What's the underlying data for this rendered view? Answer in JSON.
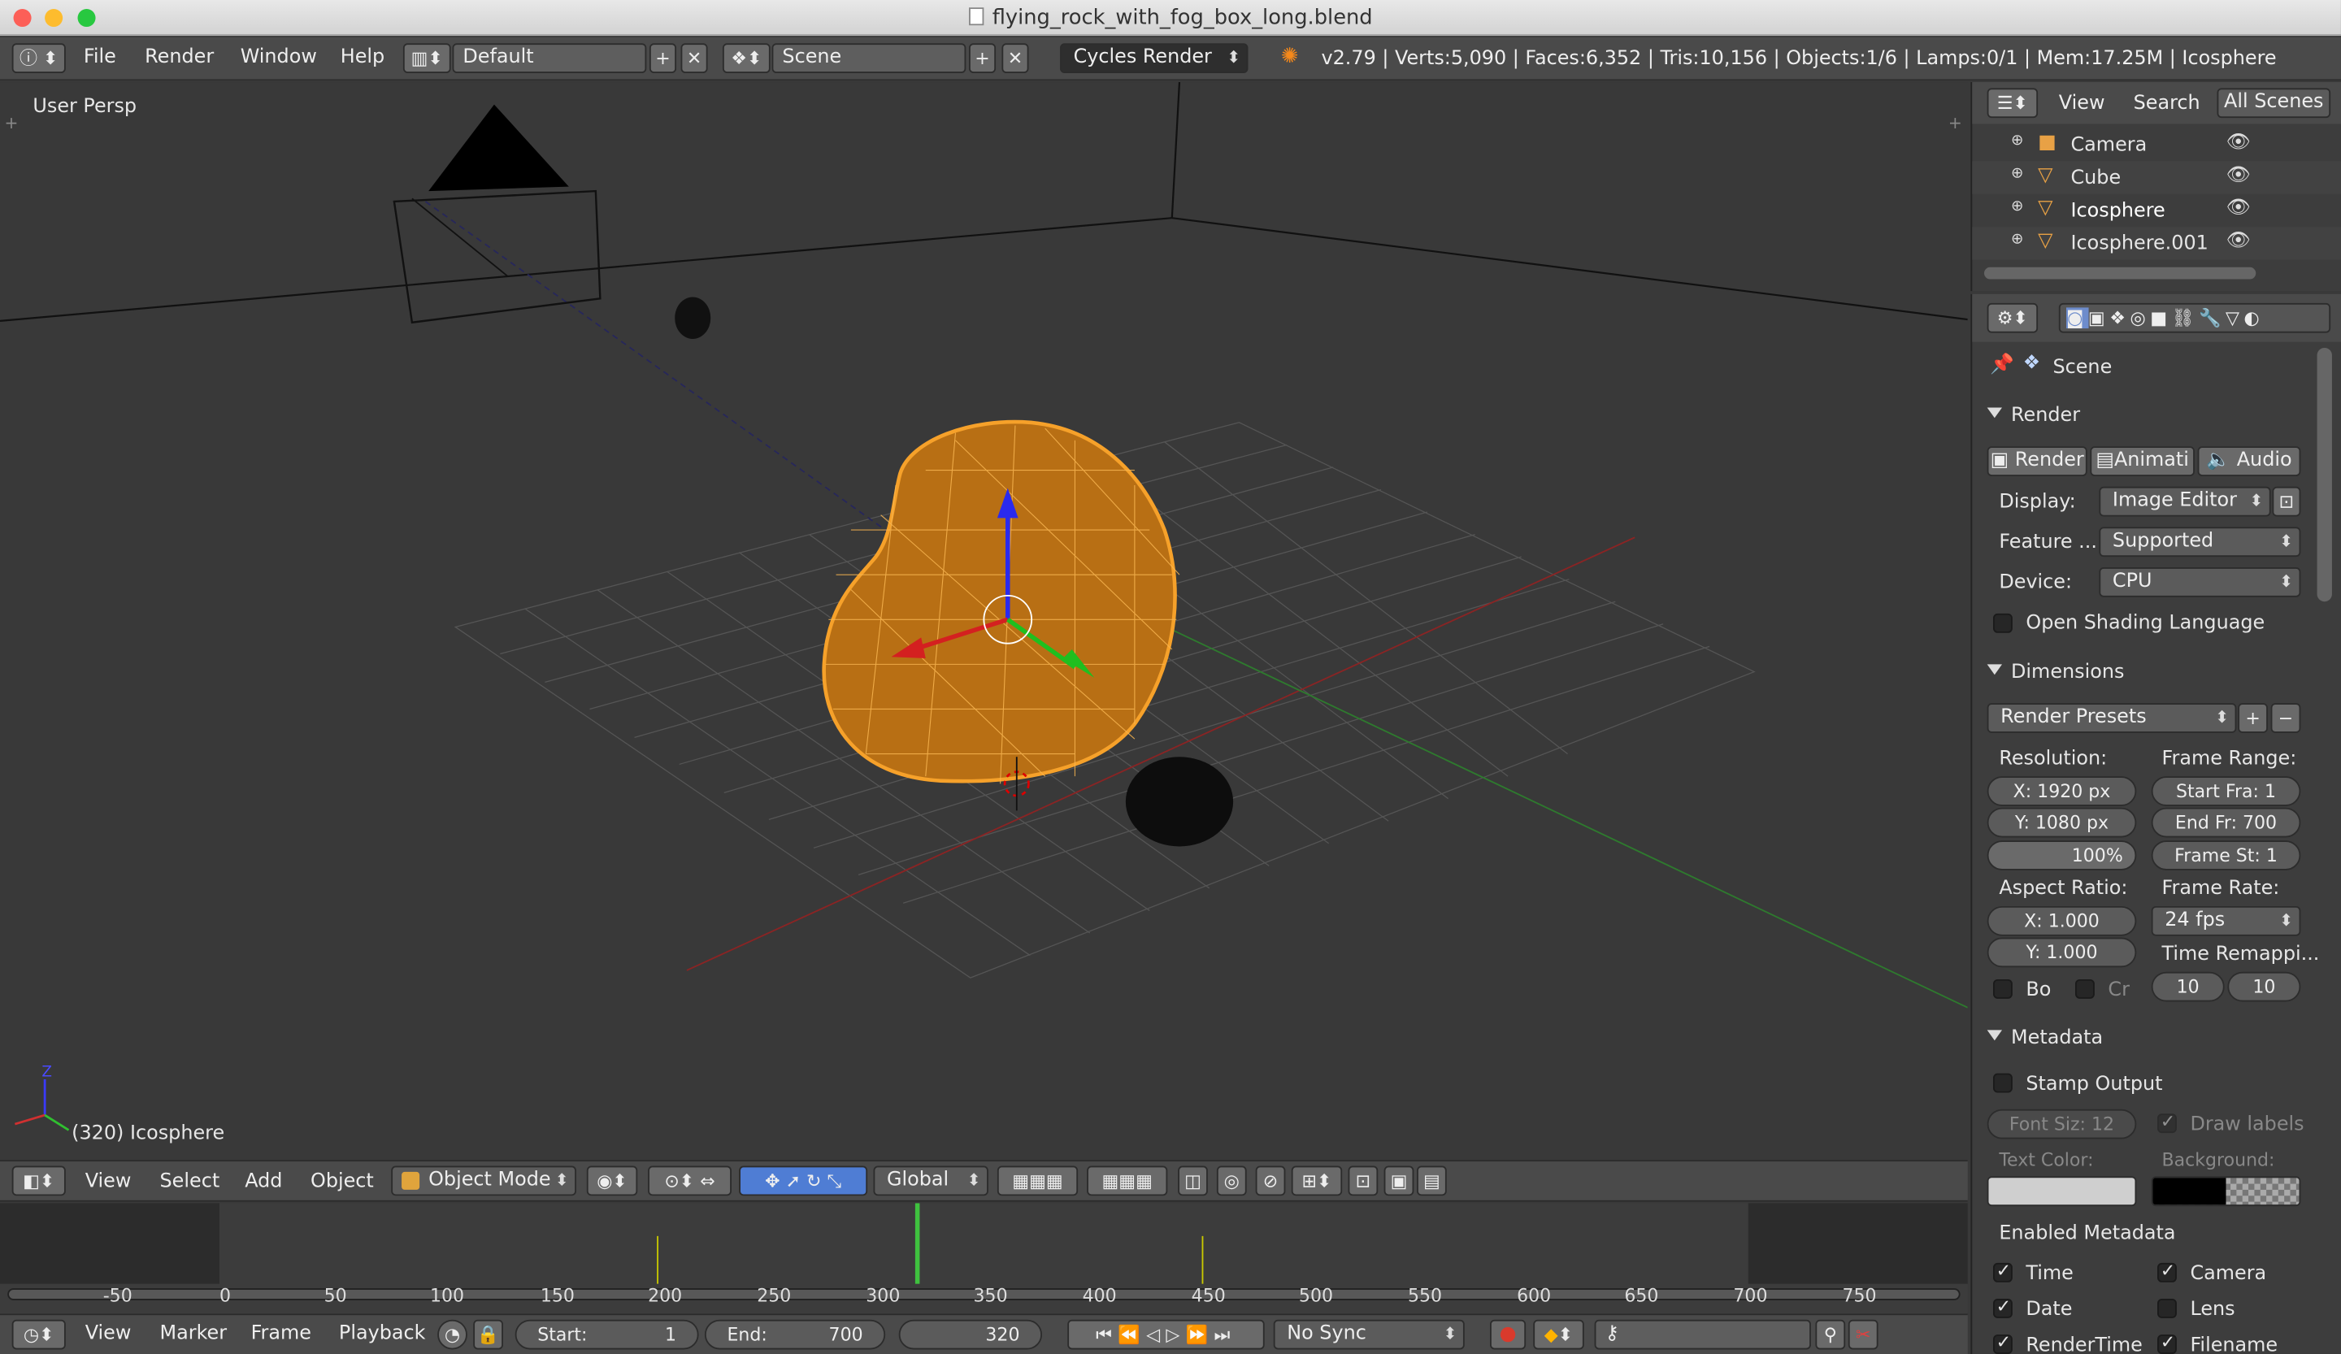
{
  "window": {
    "title": "flying_rock_with_fog_box_long.blend"
  },
  "header": {
    "menus": [
      "File",
      "Render",
      "Window",
      "Help"
    ],
    "layout": "Default",
    "scene": "Scene",
    "engine": "Cycles Render",
    "stats": "v2.79 | Verts:5,090 | Faces:6,352 | Tris:10,156 | Objects:1/6 | Lamps:0/1 | Mem:17.25M | Icosphere"
  },
  "viewport": {
    "view_name": "User Persp",
    "object_label": "(320) Icosphere",
    "axis_z": "Z",
    "accent_color": "#f6a12a"
  },
  "viewport_toolbar": {
    "view": "View",
    "select": "Select",
    "add": "Add",
    "object": "Object",
    "mode": "Object Mode",
    "orientation": "Global"
  },
  "timeline": {
    "ticks": [
      "-50",
      "0",
      "50",
      "100",
      "150",
      "200",
      "250",
      "300",
      "350",
      "400",
      "450",
      "500",
      "550",
      "600",
      "650",
      "700",
      "750"
    ],
    "menus": [
      "View",
      "Marker",
      "Frame",
      "Playback"
    ],
    "start_label": "Start:",
    "start_value": "1",
    "end_label": "End:",
    "end_value": "700",
    "current_frame": "320",
    "sync": "No Sync"
  },
  "outliner": {
    "tabs": [
      "View",
      "Search",
      "All Scenes"
    ],
    "items": [
      "Camera",
      "Cube",
      "Icosphere",
      "Icosphere.001"
    ]
  },
  "properties": {
    "context": "Scene",
    "render_section": "Render",
    "render_buttons": [
      "Render",
      "Animati",
      "Audio"
    ],
    "display_label": "Display:",
    "display_value": "Image Editor",
    "feature_label": "Feature ...",
    "feature_value": "Supported",
    "device_label": "Device:",
    "device_value": "CPU",
    "osl_label": "Open Shading Language",
    "dimensions_section": "Dimensions",
    "presets": "Render Presets",
    "resolution_label": "Resolution:",
    "res_x": "X:  1920 px",
    "res_y": "Y:  1080 px",
    "res_pct": "100%",
    "frame_range_label": "Frame Range:",
    "start_frame": "Start Fra:  1",
    "end_frame": "End Fr: 700",
    "frame_step": "Frame St: 1",
    "aspect_label": "Aspect Ratio:",
    "aspect_x": "X:   1.000",
    "aspect_y": "Y:   1.000",
    "frame_rate_label": "Frame Rate:",
    "frame_rate": "24 fps",
    "time_remap_label": "Time Remappi...",
    "remap_old": "10",
    "remap_new": "10",
    "border_label": "Bo",
    "crop_label": "Cr",
    "metadata_section": "Metadata",
    "stamp_label": "Stamp Output",
    "font_size": "Font Siz: 12",
    "draw_labels": "Draw labels",
    "text_color_label": "Text Color:",
    "background_label": "Background:",
    "enabled_metadata_label": "Enabled Metadata",
    "meta_left": [
      "Time",
      "Date",
      "RenderTime"
    ],
    "meta_right": [
      "Camera",
      "Lens",
      "Filename"
    ]
  }
}
